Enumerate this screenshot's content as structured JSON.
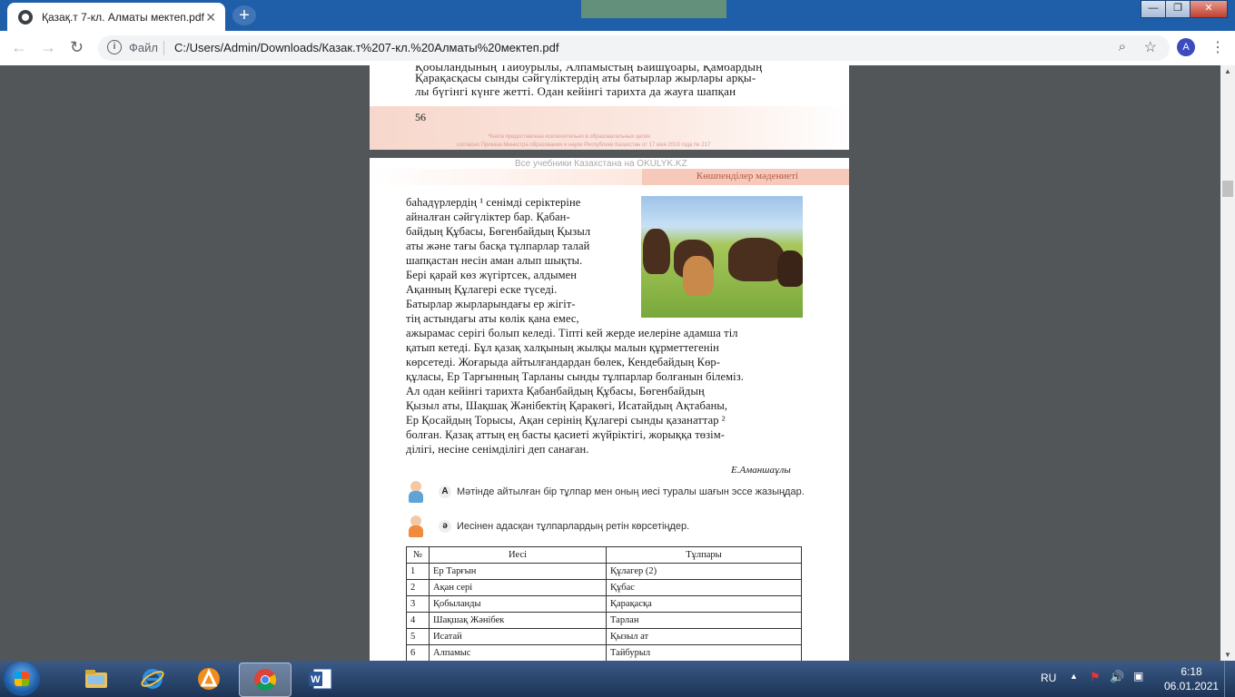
{
  "browser": {
    "tab_title": "Қазақ.т 7-кл. Алматы мектеп.pdf",
    "tab_close": "✕",
    "new_tab": "+",
    "address_scheme": "Файл",
    "address_url": "C:/Users/Admin/Downloads/Казак.т%207-кл.%20Алматы%20мектеп.pdf",
    "avatar_letter": "A",
    "window_controls": {
      "minimize": "—",
      "maximize": "❐",
      "close": "✕"
    }
  },
  "pdf": {
    "page1": {
      "lines": [
        "Қобыландының    Тайбурылы,    Алпамыстың    Байшұбары,    Қамбардың",
        "Қарақасқасы    сынды сәйгүліктердің    аты батырлар жырлары арқы-",
        "лы  бүгінгі  күнге  жетті.  Одан  кейінгі  тарихта  да жауға  шапқан"
      ],
      "page_number": "56",
      "watermark1": "*Книга предоставлена исключительно в образовательных целях",
      "watermark2": "согласно Приказа Министра образования и науки Республики Казахстан от 17 мая 2019 года № 217"
    },
    "page2": {
      "top_note": "Все учебники Казахстана на OKULYK.KZ",
      "section_header": "Көшпенділер   мәдениеті",
      "paragraph_lines": [
        "баһадүрлердің   ¹  сенімді  серіктеріне",
        "айналған    сәйгүліктер    бар.   Қабан-",
        "байдың  Құбасы,  Бөгенбайдың   Қызыл",
        "аты  және  тағы  басқа  тұлпарлар   талай",
        "шапқастан    несін  аман  алып  шықты.",
        "Бері  қарай  көз  жүгіртсек,    алдымен",
        "Ақанның   Құлагері    еске   түседі.",
        "    Батырлар   жырларындағы    ер жігіт-",
        "тің  астындағы   аты  көлік   қана   емес,",
        "ажырамас   серігі  болып  келеді.  Тіпті  кей  жерде  иелеріне  адамша  тіл",
        "қатып  кетеді.  Бұл  қазақ  халқының   жылқы  малын  құрметтегенін",
        "көрсетеді.   Жоғарыда    айтылғандардан   бөлек,  Кендебайдың   Көр-",
        "құласы,  Ер  Тарғынның   Тарланы  сынды  тұлпарлар  болғанын  білеміз.",
        "    Ал  одан  кейінгі   тарихта  Қабанбайдың    Құбасы,  Бөгенбайдың",
        "Қызыл   аты,  Шақшақ  Жәнібектің  Қаракөгі,    Исатайдың  Ақтабаны,",
        "Ер  Қосайдың   Торысы,   Ақан  серінің  Құлагері  сынды  қазанаттар  ²",
        "болған.  Қазақ   аттың  ең  басты  қасиеті  жүйріктігі,    жорыққа   төзім-",
        "ділігі,   несіне   сенімділігі    деп  санаған."
      ],
      "author": "Е.Аманшаұлы",
      "task_a_letter": "А",
      "task_a_text": "Мәтінде айтылған бір тұлпар мен оның иесі туралы шағын эссе жазыңдар.",
      "task_b_letter": "ә",
      "task_b_text": "Иесінен адасқан тұлпарлардың ретін көрсетіңдер.",
      "table": {
        "headers": [
          "№",
          "Иесі",
          "Тұлпары"
        ],
        "rows": [
          [
            "1",
            "Ер  Тарғын",
            "Құлагер    (2)"
          ],
          [
            "2",
            "Ақан   сері",
            "Құбас"
          ],
          [
            "3",
            "Қобыланды",
            "Қарақасқа"
          ],
          [
            "4",
            "Шақшақ    Жәнібек",
            "Тарлан"
          ],
          [
            "5",
            "Исатай",
            "Қызыл    ат"
          ],
          [
            "6",
            "Алпамыс",
            "Тайбурыл"
          ]
        ]
      }
    }
  },
  "taskbar": {
    "language": "RU",
    "time": "6:18",
    "date": "06.01.2021",
    "items": [
      "explorer-icon",
      "internet-explorer-icon",
      "avast-icon",
      "chrome-icon",
      "word-icon"
    ]
  }
}
